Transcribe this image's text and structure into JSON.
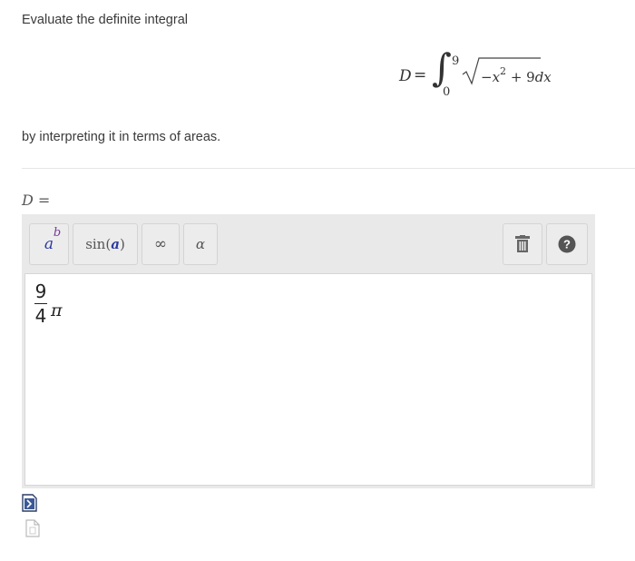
{
  "question": {
    "intro": "Evaluate the definite integral",
    "formula": {
      "variable": "D",
      "equals": "=",
      "integral_sign": "∫",
      "upper_limit": "9",
      "lower_limit": "0",
      "radicand_minus": "−",
      "radicand_var": "x",
      "radicand_power": "2",
      "radicand_rest": " + 9",
      "differential": "dx"
    },
    "after": "by interpreting it in terms of areas."
  },
  "answer": {
    "label_var": "D",
    "label_eq": " ="
  },
  "toolbar": {
    "power_base": "a",
    "power_exp": "b",
    "sin_fn": "sin",
    "sin_open": " (",
    "sin_arg": "a",
    "sin_close": ")",
    "infinity": "∞",
    "alpha": "α",
    "icons": [
      "trash-icon",
      "help-icon"
    ]
  },
  "input": {
    "numerator": "9",
    "denominator": "4",
    "symbol": "π"
  },
  "colors": {
    "toolbar_bg": "#e9e9e9",
    "button_bg": "#ececec",
    "accent_blue": "#2a3a9e",
    "accent_purple": "#7a3a9a",
    "help_icon": "#555555"
  }
}
